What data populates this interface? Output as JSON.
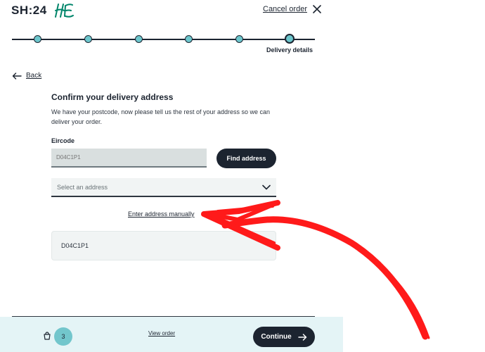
{
  "header": {
    "logo_text": "SH:24",
    "partner_logo_text": "HSE",
    "cancel_label": "Cancel order"
  },
  "stepper": {
    "step_count": 6,
    "current_step": 6,
    "current_label": "Delivery details",
    "color_done": "#6cc6cc"
  },
  "nav": {
    "back_label": "Back"
  },
  "form": {
    "title": "Confirm your delivery address",
    "intro": "We have your postcode, now please tell us the rest of your address so we can deliver your order.",
    "eircode_label": "Eircode",
    "eircode_placeholder": "D04C1P1",
    "find_button": "Find address",
    "address_select_placeholder": "Select an address",
    "manual_link": "Enter address manually",
    "manual_address_value": "D04C1P1"
  },
  "footer": {
    "basket_count": "3",
    "view_order": "View order",
    "continue_label": "Continue",
    "background": "#e4f4f6"
  },
  "annotation": {
    "type": "hand-drawn red arrow pointing to Enter address manually",
    "color": "#ff0000"
  }
}
